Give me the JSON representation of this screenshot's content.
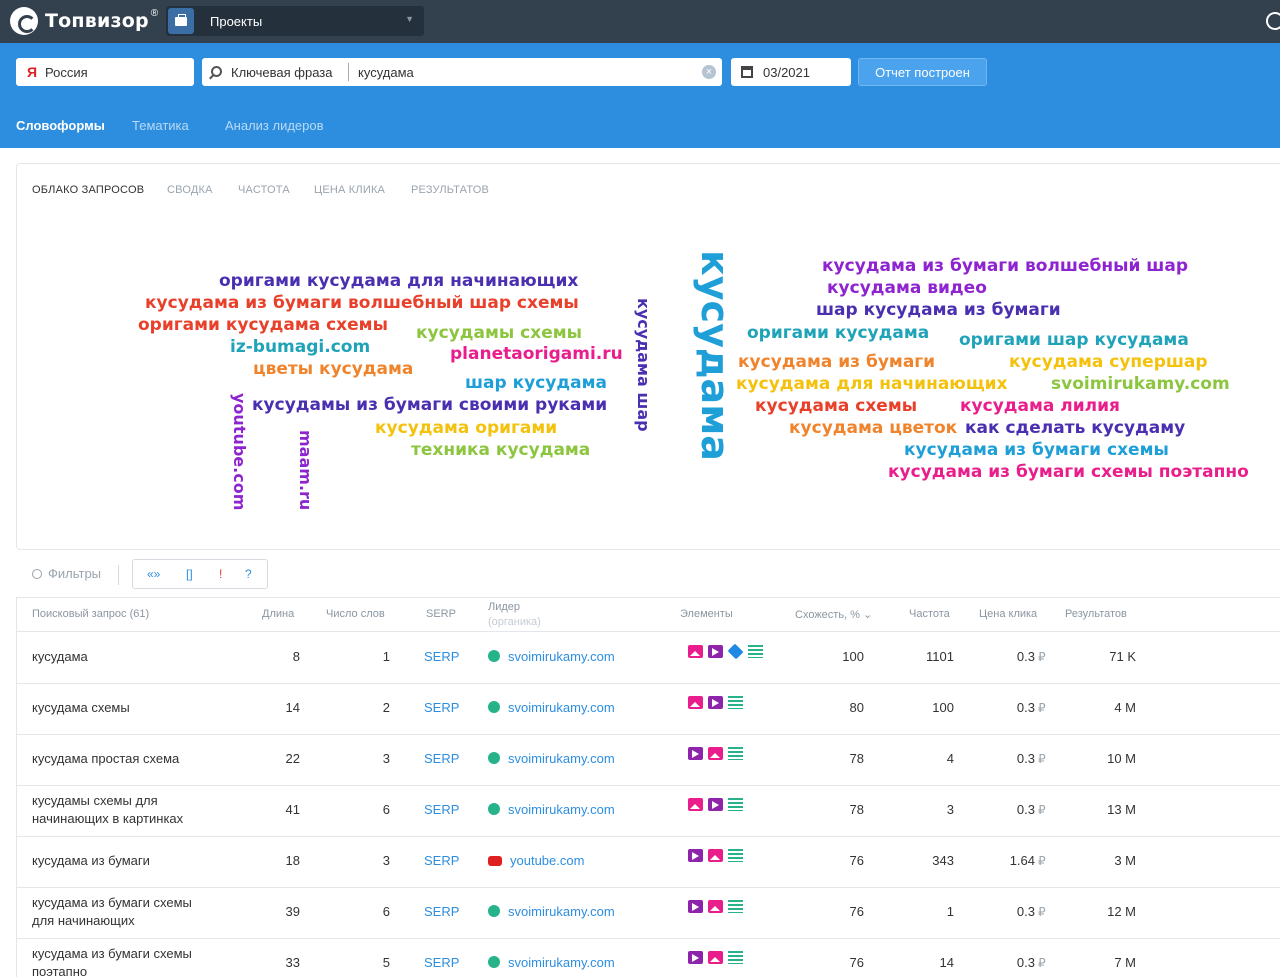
{
  "app": {
    "name": "Топвизор",
    "reg": "®"
  },
  "topbar": {
    "projects_label": "Проекты"
  },
  "search": {
    "region": "Россия",
    "region_icon": "Я",
    "mode": "Ключевая фраза",
    "query": "кусудама",
    "date": "03/2021",
    "report_button": "Отчет построен"
  },
  "subnav": [
    "Словоформы",
    "Тематика",
    "Анализ лидеров"
  ],
  "card_tabs": [
    "ОБЛАКО ЗАПРОСОВ",
    "СВОДКА",
    "ЧАСТОТА",
    "ЦЕНА КЛИКА",
    "РЕЗУЛЬТАТОВ"
  ],
  "cloud": {
    "words": [
      {
        "text": "оригами кусудама для начинающих",
        "color": "#4a2fb0"
      },
      {
        "text": "кусудама из бумаги волшебный шар схемы",
        "color": "#e8402a"
      },
      {
        "text": "оригами кусудама схемы",
        "color": "#e8402a"
      },
      {
        "text": "iz-bumagi.com",
        "color": "#1fa3b8"
      },
      {
        "text": "кусудамы схемы",
        "color": "#8cc63f"
      },
      {
        "text": "planetaorigami.ru",
        "color": "#e91e8c"
      },
      {
        "text": "цветы кусудама",
        "color": "#f0842c"
      },
      {
        "text": "шар кусудама",
        "color": "#1e9fd8"
      },
      {
        "text": "кусудамы из бумаги своими руками",
        "color": "#4a2fb0"
      },
      {
        "text": "кусудама оригами",
        "color": "#f4c20d"
      },
      {
        "text": "техника кусудама",
        "color": "#8cc63f"
      },
      {
        "text": "кусудама из бумаги волшебный шар",
        "color": "#8e24d0"
      },
      {
        "text": "кусудама видео",
        "color": "#8e24d0"
      },
      {
        "text": "шар кусудама из бумаги",
        "color": "#4a2fb0"
      },
      {
        "text": "оригами кусудама",
        "color": "#1fa3b8"
      },
      {
        "text": "оригами шар кусудама",
        "color": "#1fa3b8"
      },
      {
        "text": "кусудама из бумаги",
        "color": "#f0842c"
      },
      {
        "text": "кусудама супершар",
        "color": "#f4c20d"
      },
      {
        "text": "кусудама для начинающих",
        "color": "#f4c20d"
      },
      {
        "text": "svoimirukamy.com",
        "color": "#8cc63f"
      },
      {
        "text": "кусудама схемы",
        "color": "#e8402a"
      },
      {
        "text": "кусудама лилия",
        "color": "#e91e8c"
      },
      {
        "text": "кусудама цветок",
        "color": "#f0842c"
      },
      {
        "text": "как сделать кусудаму",
        "color": "#4a2fb0"
      },
      {
        "text": "кусудама из бумаги схемы",
        "color": "#1e9fd8"
      },
      {
        "text": "кусудама из бумаги схемы поэтапно",
        "color": "#e91e8c"
      }
    ],
    "vertical": [
      {
        "text": "youtube.com",
        "color": "#8e24d0"
      },
      {
        "text": "maam.ru",
        "color": "#8e24d0"
      },
      {
        "text": "кусудама шар",
        "color": "#4a2fb0"
      },
      {
        "text": "кусудама",
        "color": "#1e9fd8"
      }
    ]
  },
  "filters": {
    "label": "Фильтры",
    "chips": [
      "«»",
      "[]",
      "!",
      "?"
    ]
  },
  "table": {
    "headers": {
      "query": "Поисковый запрос (61)",
      "length": "Длина",
      "words": "Число слов",
      "serp": "SERP",
      "leader": "Лидер",
      "leader_sub": "(органика)",
      "elements": "Элементы",
      "similarity": "Схожесть, % ⌄",
      "frequency": "Частота",
      "cpc": "Цена клика",
      "results": "Результатов"
    },
    "rows": [
      {
        "query_l1": "кусудама",
        "query_l2": "",
        "length": "8",
        "words": "1",
        "serp": "SERP",
        "leader": "svoimirukamy.com",
        "leader_icon": "globe-icon",
        "elements": [
          "img",
          "vid",
          "cube",
          "list"
        ],
        "similarity": "100",
        "frequency": "1101",
        "cpc": "0.3",
        "cur": "₽",
        "results": "71 K"
      },
      {
        "query_l1": "кусудама схемы",
        "query_l2": "",
        "length": "14",
        "words": "2",
        "serp": "SERP",
        "leader": "svoimirukamy.com",
        "leader_icon": "globe-icon",
        "elements": [
          "img",
          "vid",
          "list"
        ],
        "similarity": "80",
        "frequency": "100",
        "cpc": "0.3",
        "cur": "₽",
        "results": "4 M"
      },
      {
        "query_l1": "кусудама простая схема",
        "query_l2": "",
        "length": "22",
        "words": "3",
        "serp": "SERP",
        "leader": "svoimirukamy.com",
        "leader_icon": "globe-icon",
        "elements": [
          "vid",
          "img",
          "list"
        ],
        "similarity": "78",
        "frequency": "4",
        "cpc": "0.3",
        "cur": "₽",
        "results": "10 M"
      },
      {
        "query_l1": "кусудамы схемы для",
        "query_l2": "начинающих в картинках",
        "length": "41",
        "words": "6",
        "serp": "SERP",
        "leader": "svoimirukamy.com",
        "leader_icon": "globe-icon",
        "elements": [
          "img",
          "vid",
          "list"
        ],
        "similarity": "78",
        "frequency": "3",
        "cpc": "0.3",
        "cur": "₽",
        "results": "13 M"
      },
      {
        "query_l1": "кусудама из бумаги",
        "query_l2": "",
        "length": "18",
        "words": "3",
        "serp": "SERP",
        "leader": "youtube.com",
        "leader_icon": "youtube-icon",
        "elements": [
          "vid",
          "img",
          "list"
        ],
        "similarity": "76",
        "frequency": "343",
        "cpc": "1.64",
        "cur": "₽",
        "results": "3 M"
      },
      {
        "query_l1": "кусудама из бумаги схемы",
        "query_l2": "для начинающих",
        "length": "39",
        "words": "6",
        "serp": "SERP",
        "leader": "svoimirukamy.com",
        "leader_icon": "globe-icon",
        "elements": [
          "vid",
          "img",
          "list"
        ],
        "similarity": "76",
        "frequency": "1",
        "cpc": "0.3",
        "cur": "₽",
        "results": "12 M"
      },
      {
        "query_l1": "кусудама из бумаги схемы",
        "query_l2": "поэтапно",
        "length": "33",
        "words": "5",
        "serp": "SERP",
        "leader": "svoimirukamy.com",
        "leader_icon": "globe-icon",
        "elements": [
          "vid",
          "img",
          "list"
        ],
        "similarity": "76",
        "frequency": "14",
        "cpc": "0.3",
        "cur": "₽",
        "results": "7 M"
      }
    ]
  }
}
